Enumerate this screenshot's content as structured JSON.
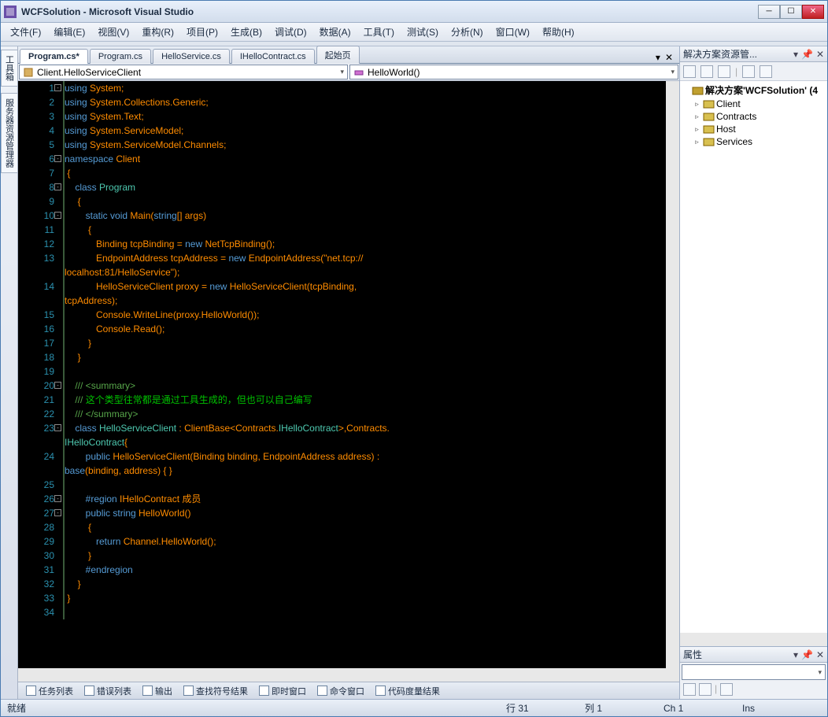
{
  "window": {
    "title": "WCFSolution - Microsoft Visual Studio"
  },
  "menubar": [
    "文件(F)",
    "编辑(E)",
    "视图(V)",
    "重构(R)",
    "项目(P)",
    "生成(B)",
    "调试(D)",
    "数据(A)",
    "工具(T)",
    "测试(S)",
    "分析(N)",
    "窗口(W)",
    "帮助(H)"
  ],
  "leftbar": [
    "工具箱",
    "服务器资源管理器"
  ],
  "doc_tabs": {
    "items": [
      "Program.cs*",
      "Program.cs",
      "HelloService.cs",
      "IHelloContract.cs",
      "起始页"
    ],
    "active_index": 0
  },
  "nav": {
    "left": "Client.HelloServiceClient",
    "right": "HelloWorld()"
  },
  "code_lines": [
    {
      "n": 1,
      "o": "-",
      "h": "<span class='kw'>using</span> System;"
    },
    {
      "n": 2,
      "o": " ",
      "h": "<span class='kw'>using</span> System.Collections.Generic;"
    },
    {
      "n": 3,
      "o": " ",
      "h": "<span class='kw'>using</span> System.Text;"
    },
    {
      "n": 4,
      "o": " ",
      "h": "<span class='kw'>using</span> System.ServiceModel;"
    },
    {
      "n": 5,
      "o": " ",
      "h": "<span class='kw'>using</span> System.ServiceModel.Channels;"
    },
    {
      "n": 6,
      "o": "-",
      "h": "<span class='kw'>namespace</span> Client"
    },
    {
      "n": 7,
      "o": " ",
      "h": " {"
    },
    {
      "n": 8,
      "o": "-",
      "h": "    <span class='kw'>class</span> <span class='type'>Program</span>"
    },
    {
      "n": 9,
      "o": " ",
      "h": "     {"
    },
    {
      "n": 10,
      "o": "-",
      "h": "        <span class='kw'>static</span> <span class='kw'>void</span> Main(<span class='kw'>string</span>[] args)"
    },
    {
      "n": 11,
      "o": " ",
      "h": "         {"
    },
    {
      "n": 12,
      "o": " ",
      "h": "            Binding tcpBinding = <span class='kw'>new</span> NetTcpBinding();"
    },
    {
      "n": 13,
      "o": " ",
      "h": "            EndpointAddress tcpAddress = <span class='kw'>new</span> EndpointAddress(<span class='str'>\"net.tcp://</span>\nlocalhost:81/HelloService\");"
    },
    {
      "n": 14,
      "o": " ",
      "h": "            HelloServiceClient proxy = <span class='kw'>new</span> HelloServiceClient(tcpBinding, \ntcpAddress);"
    },
    {
      "n": 15,
      "o": " ",
      "h": "            Console.WriteLine(proxy.HelloWorld());"
    },
    {
      "n": 16,
      "o": " ",
      "h": "            Console.Read();"
    },
    {
      "n": 17,
      "o": " ",
      "h": "         }"
    },
    {
      "n": 18,
      "o": " ",
      "h": "     }"
    },
    {
      "n": 19,
      "o": " ",
      "h": ""
    },
    {
      "n": 20,
      "o": "-",
      "h": "    <span class='cmt'>/// &lt;summary&gt;</span>"
    },
    {
      "n": 21,
      "o": " ",
      "h": "    <span class='cmt'>///</span> <span class='cmt2'>这个类型往常都是通过工具生成的，但也可以自己编写</span>"
    },
    {
      "n": 22,
      "o": " ",
      "h": "    <span class='cmt'>/// &lt;/summary&gt;</span>"
    },
    {
      "n": 23,
      "o": "-",
      "h": "    <span class='kw'>class</span> <span class='type'>HelloServiceClient</span> : ClientBase&lt;Contracts.<span class='type'>IHelloContract</span>&gt;,Contracts.\n<span class='type'>IHelloContract</span>{"
    },
    {
      "n": 24,
      "o": " ",
      "h": "        <span class='kw'>public</span> HelloServiceClient(Binding binding, EndpointAddress address) : \n<span class='kw'>base</span>(binding, address) { }"
    },
    {
      "n": 25,
      "o": " ",
      "h": ""
    },
    {
      "n": 26,
      "o": "-",
      "h": "        <span class='kw'>#region</span> IHelloContract 成员"
    },
    {
      "n": 27,
      "o": "-",
      "h": "        <span class='kw'>public</span> <span class='kw'>string</span> HelloWorld()"
    },
    {
      "n": 28,
      "o": " ",
      "h": "         {"
    },
    {
      "n": 29,
      "o": " ",
      "h": "            <span class='kw'>return</span> Channel.HelloWorld();"
    },
    {
      "n": 30,
      "o": " ",
      "h": "         }"
    },
    {
      "n": 31,
      "o": " ",
      "h": "        <span class='kw'>#endregion</span>"
    },
    {
      "n": 32,
      "o": " ",
      "h": "     }"
    },
    {
      "n": 33,
      "o": " ",
      "h": " }"
    },
    {
      "n": 34,
      "o": " ",
      "h": ""
    }
  ],
  "bottom_tabs": [
    "任务列表",
    "错误列表",
    "输出",
    "查找符号结果",
    "即时窗口",
    "命令窗口",
    "代码度量结果"
  ],
  "solution_panel": {
    "title": "解决方案资源管...",
    "root": "解决方案'WCFSolution' (4",
    "projects": [
      "Client",
      "Contracts",
      "Host",
      "Services"
    ]
  },
  "properties_panel": {
    "title": "属性"
  },
  "statusbar": {
    "status": "就绪",
    "line": "行 31",
    "col": "列 1",
    "ch": "Ch 1",
    "ins": "Ins"
  }
}
